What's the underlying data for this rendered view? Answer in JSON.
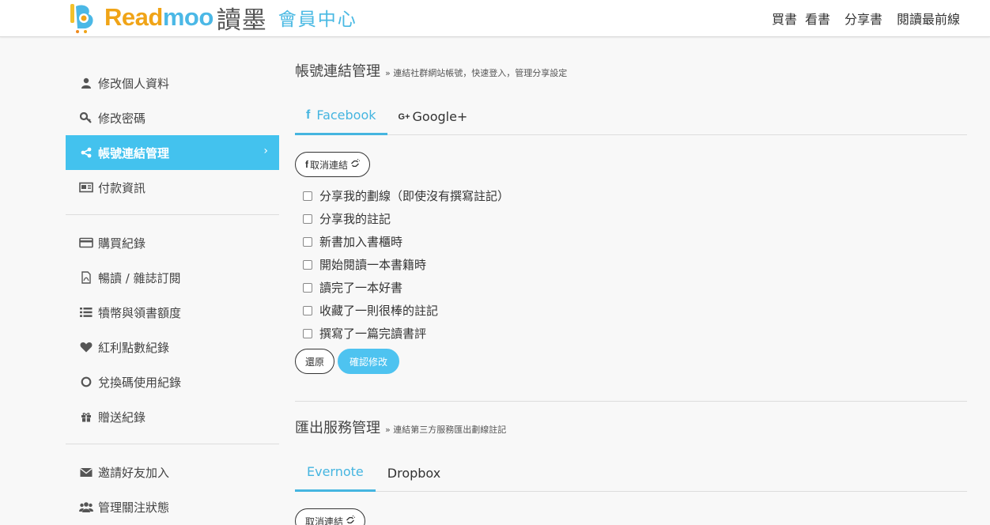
{
  "header": {
    "brand_a": "Read",
    "brand_b": "moo",
    "brand_cn": "讀墨",
    "brand_center": "會員中心",
    "nav": [
      "買書",
      "看書",
      "分享書",
      "閱讀最前線"
    ]
  },
  "sidebar": {
    "group1": [
      {
        "label": "修改個人資料",
        "icon": "user-icon"
      },
      {
        "label": "修改密碼",
        "icon": "key-icon"
      },
      {
        "label": "帳號連結管理",
        "icon": "share-icon",
        "active": true
      },
      {
        "label": "付款資訊",
        "icon": "card-icon"
      }
    ],
    "group2": [
      {
        "label": "購買紀錄",
        "icon": "credit-card-icon"
      },
      {
        "label": "暢讀 / 雜誌訂閱",
        "icon": "document-icon"
      },
      {
        "label": "犢幣與領書額度",
        "icon": "list-icon"
      },
      {
        "label": "紅利點數紀錄",
        "icon": "heart-icon"
      },
      {
        "label": "兌換碼使用紀錄",
        "icon": "circle-icon"
      },
      {
        "label": "贈送紀錄",
        "icon": "gift-icon"
      }
    ],
    "group3": [
      {
        "label": "邀請好友加入",
        "icon": "envelope-icon"
      },
      {
        "label": "管理關注狀態",
        "icon": "users-icon"
      }
    ],
    "active_chevron": "›"
  },
  "account_link": {
    "title": "帳號連結管理",
    "subtitle": "» 連結社群網站帳號，快速登入，管理分享設定",
    "tabs": [
      {
        "label": "Facebook",
        "active": true
      },
      {
        "label": "Google+",
        "active": false
      }
    ],
    "fb_glyph": "f",
    "gplus_glyph": "G+",
    "unlink_label": "取消連結",
    "options": [
      "分享我的劃線（即使沒有撰寫註記）",
      "分享我的註記",
      "新書加入書櫃時",
      "開始閱讀一本書籍時",
      "讀完了一本好書",
      "收藏了一則很棒的註記",
      "撰寫了一篇完讀書評"
    ],
    "revert_label": "還原",
    "confirm_label": "確認修改"
  },
  "export_service": {
    "title": "匯出服務管理",
    "subtitle": "» 連結第三方服務匯出劃線註記",
    "tabs": [
      {
        "label": "Evernote",
        "active": true
      },
      {
        "label": "Dropbox",
        "active": false
      }
    ],
    "unlink_label": "取消連結"
  },
  "colors": {
    "accent": "#43c2ee",
    "brand_orange": "#f0a417",
    "tab_active": "#45b5e0"
  }
}
